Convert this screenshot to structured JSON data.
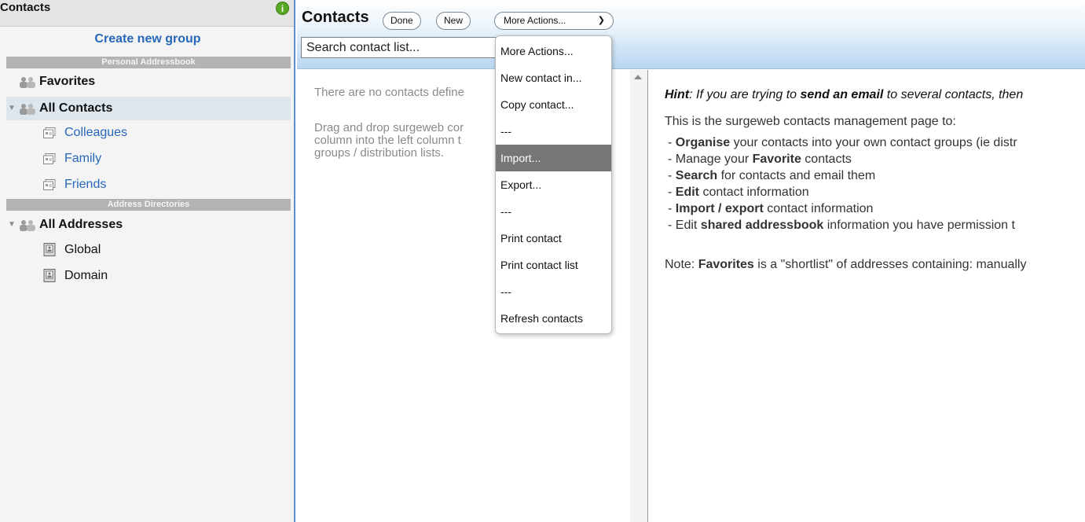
{
  "sidebar": {
    "title": "Contacts",
    "info_icon_glyph": "i",
    "create_group_label": "Create new group",
    "personal_section": "Personal Addressbook",
    "favorites": "Favorites",
    "all_contacts": "All Contacts",
    "groups": [
      "Colleagues",
      "Family",
      "Friends"
    ],
    "directories_section": "Address Directories",
    "all_addresses": "All Addresses",
    "directories": [
      "Global",
      "Domain"
    ]
  },
  "toolbar": {
    "title": "Contacts",
    "done_label": "Done",
    "new_label": "New",
    "more_actions_label": "More Actions...",
    "search_value": "Search contact list..."
  },
  "list": {
    "empty_message": "There are no contacts define",
    "drag_line1": "Drag and drop surgeweb cor",
    "drag_line2": "column into the left column t",
    "drag_line3": "groups / distribution lists."
  },
  "menu": {
    "items": [
      "More Actions...",
      "New contact in...",
      "Copy contact...",
      "---",
      "Import...",
      "Export...",
      "---",
      "Print contact",
      "Print contact list",
      "---",
      "Refresh contacts"
    ],
    "highlighted_index": 4
  },
  "hint": {
    "hint_word": "Hint",
    "hint_text1": ": If you are trying to ",
    "hint_bold": "send an email",
    "hint_text2": " to several contacts, then",
    "intro": "This is the surgeweb contacts management page to:",
    "items": [
      {
        "pre": "- ",
        "bold": "Organise",
        "post": " your contacts into your own contact groups (ie distr"
      },
      {
        "pre": "- Manage your ",
        "bold": "Favorite",
        "post": " contacts"
      },
      {
        "pre": "- ",
        "bold": "Search",
        "post": " for contacts and email them"
      },
      {
        "pre": "- ",
        "bold": "Edit",
        "post": " contact information"
      },
      {
        "pre": "- ",
        "bold": "Import / export",
        "post": " contact information"
      },
      {
        "pre": "- Edit ",
        "bold": "shared addressbook",
        "post": " information you have permission t"
      }
    ],
    "note_pre": "Note: ",
    "note_bold": "Favorites",
    "note_post": " is a \"shortlist\" of addresses containing: manually"
  },
  "colors": {
    "accent_blue": "#2767b8",
    "sidebar_border": "#5b8fc7",
    "menu_highlight": "#767676",
    "info_green": "#58a822"
  }
}
